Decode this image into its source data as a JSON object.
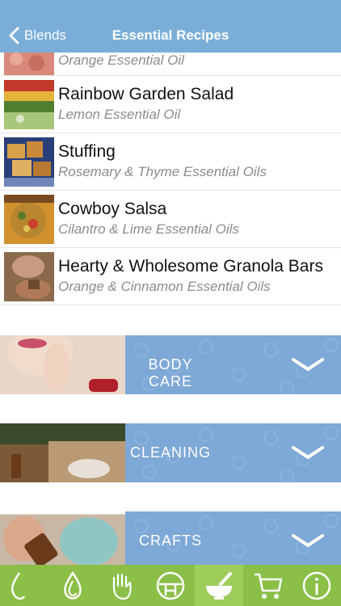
{
  "nav": {
    "back_label": "Blends",
    "title": "Essential Recipes"
  },
  "recipes": [
    {
      "title": "",
      "subtitle": "Orange Essential Oil"
    },
    {
      "title": "Rainbow Garden Salad",
      "subtitle": "Lemon Essential Oil"
    },
    {
      "title": "Stuffing",
      "subtitle": "Rosemary & Thyme Essential Oils"
    },
    {
      "title": "Cowboy Salsa",
      "subtitle": "Cilantro & Lime Essential Oils"
    },
    {
      "title": "Hearty & Wholesome Granola Bars",
      "subtitle": "Orange & Cinnamon Essential Oils"
    }
  ],
  "categories": [
    {
      "label": "BODY CARE"
    },
    {
      "label": "CLEANING"
    },
    {
      "label": "CRAFTS"
    }
  ],
  "tabs": [
    {
      "icon": "drop-icon"
    },
    {
      "icon": "double-drop-icon"
    },
    {
      "icon": "hand-icon"
    },
    {
      "icon": "compass-icon"
    },
    {
      "icon": "mortar-pestle-icon",
      "active": true
    },
    {
      "icon": "cart-icon"
    },
    {
      "icon": "info-icon"
    }
  ],
  "colors": {
    "navbar": "#7aaed9",
    "band": "#7ea8d6",
    "tabbar": "#8bbf48",
    "subtitle": "#8c8c8c"
  }
}
